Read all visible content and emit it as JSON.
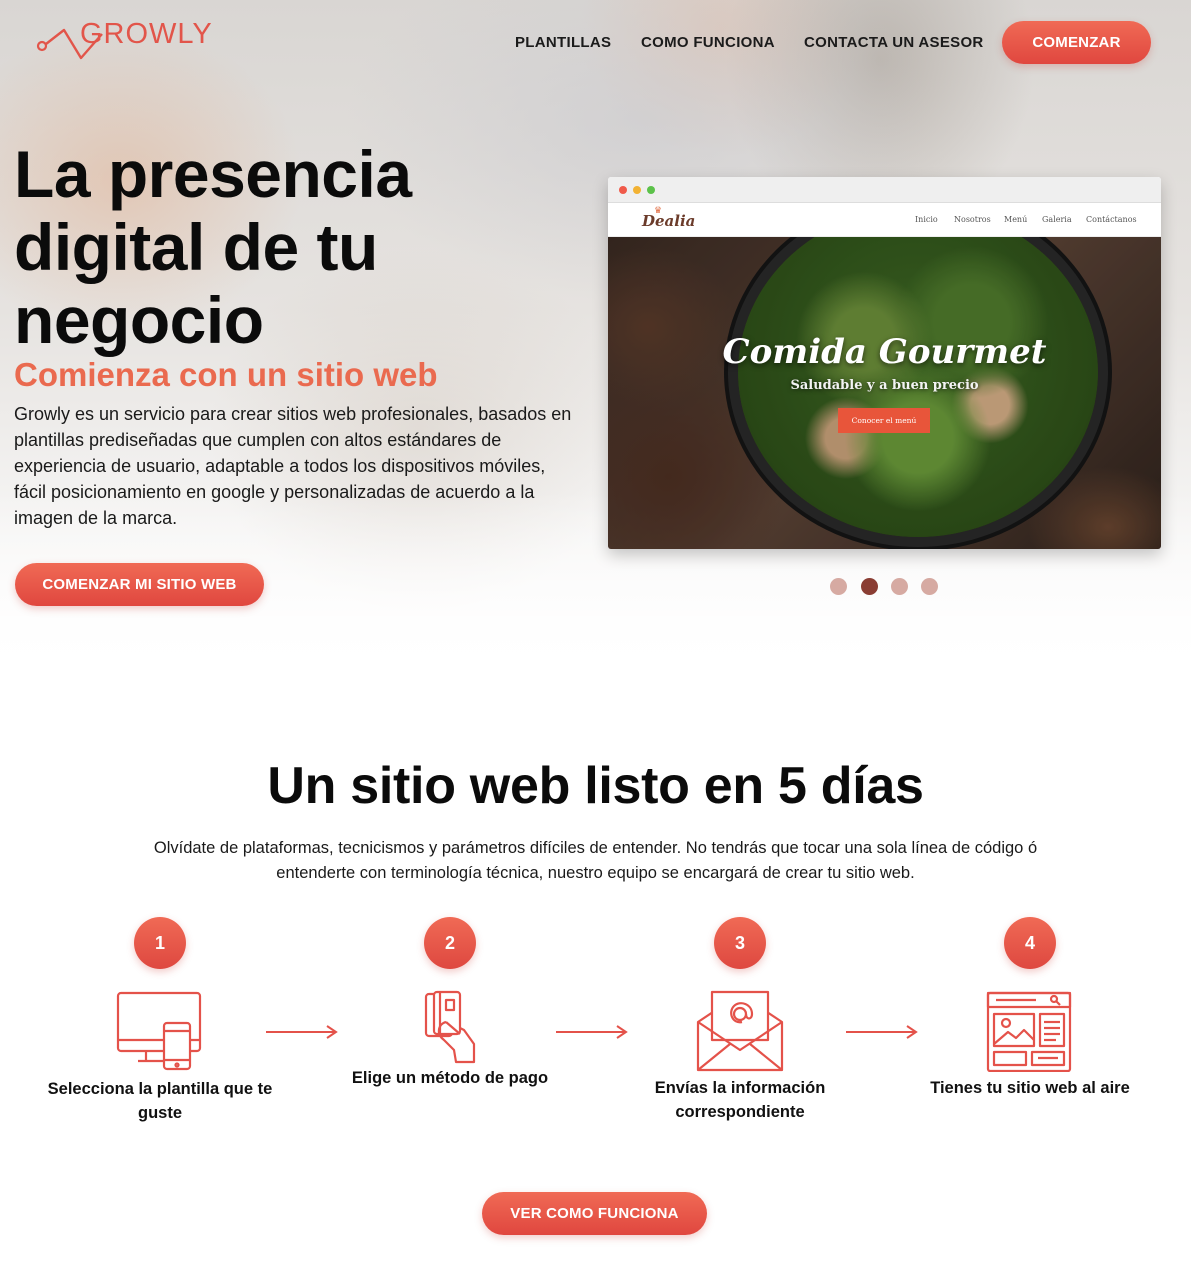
{
  "brand": {
    "name": "GROWLY",
    "accent": "#e2554a",
    "accent_light": "#f06a55"
  },
  "nav": {
    "items": [
      "PLANTILLAS",
      "COMO FUNCIONA",
      "CONTACTA UN ASESOR"
    ],
    "cta": "COMENZAR"
  },
  "hero": {
    "title_lines": [
      "La presencia",
      "digital de tu",
      "negocio"
    ],
    "subtitle": "Comienza con un sitio web",
    "description": "Growly es un servicio para crear sitios web profesionales, basados en plantillas prediseñadas que cumplen con altos estándares de experiencia de usuario, adaptable a todos los dispositivos móviles, fácil posicionamiento en google y personalizadas de acuerdo a la imagen de la marca.",
    "cta": "COMENZAR MI SITIO WEB"
  },
  "mockup": {
    "logo": "Dealia",
    "nav": [
      "Inicio",
      "Nosotros",
      "Menú",
      "Galeria",
      "Contáctanos"
    ],
    "headline": "Comida Gourmet",
    "subheadline": "Saludable y a buen precio",
    "button": "Conocer el menú"
  },
  "carousel": {
    "count": 4,
    "active_index": 1
  },
  "steps_section": {
    "title": "Un sitio web listo en 5 días",
    "description": "Olvídate de plataformas, tecnicismos y parámetros difíciles de entender. No tendrás que tocar una sola línea de código ó entenderte con terminología técnica, nuestro equipo se encargará de crear tu sitio web.",
    "steps": [
      {
        "number": "1",
        "label": "Selecciona la plantilla que te guste",
        "icon": "devices-icon"
      },
      {
        "number": "2",
        "label": "Elige un método de pago",
        "icon": "card-payment-icon"
      },
      {
        "number": "3",
        "label": "Envías la información correspondiente",
        "icon": "email-envelope-icon"
      },
      {
        "number": "4",
        "label": "Tienes tu sitio web al aire",
        "icon": "website-layout-icon"
      }
    ],
    "cta": "VER COMO FUNCIONA"
  }
}
